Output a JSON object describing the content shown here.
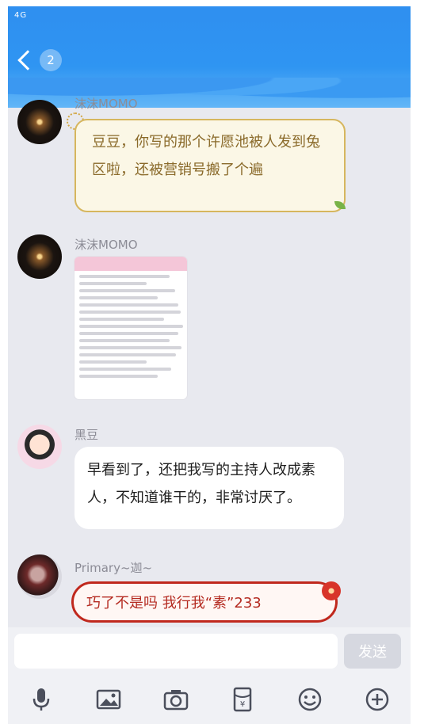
{
  "status_bar": {
    "signal": "4G"
  },
  "header": {
    "back_count": "2"
  },
  "messages": [
    {
      "sender": "沫沫MOMO",
      "type": "text",
      "text": "豆豆，你写的那个许愿池被人发到兔区啦，还被营销号搬了个遍"
    },
    {
      "sender": "沫沫MOMO",
      "type": "image"
    },
    {
      "sender": "黑豆",
      "type": "text",
      "text": "早看到了，还把我写的主持人改成素人，不知道谁干的，非常讨厌了。"
    },
    {
      "sender": "Primary~迦~",
      "type": "text",
      "text": "巧了不是吗 我行我“素”233"
    }
  ],
  "input": {
    "placeholder": "",
    "send_label": "发送"
  },
  "toolbar": {
    "icons": [
      "microphone-icon",
      "image-icon",
      "camera-icon",
      "red-packet-icon",
      "emoji-icon",
      "plus-icon"
    ]
  },
  "colors": {
    "header": "#2f8ff0",
    "background": "#e8e9ef",
    "red_bubble": "#c0281d",
    "sun_bubble": "#d6b65e"
  }
}
